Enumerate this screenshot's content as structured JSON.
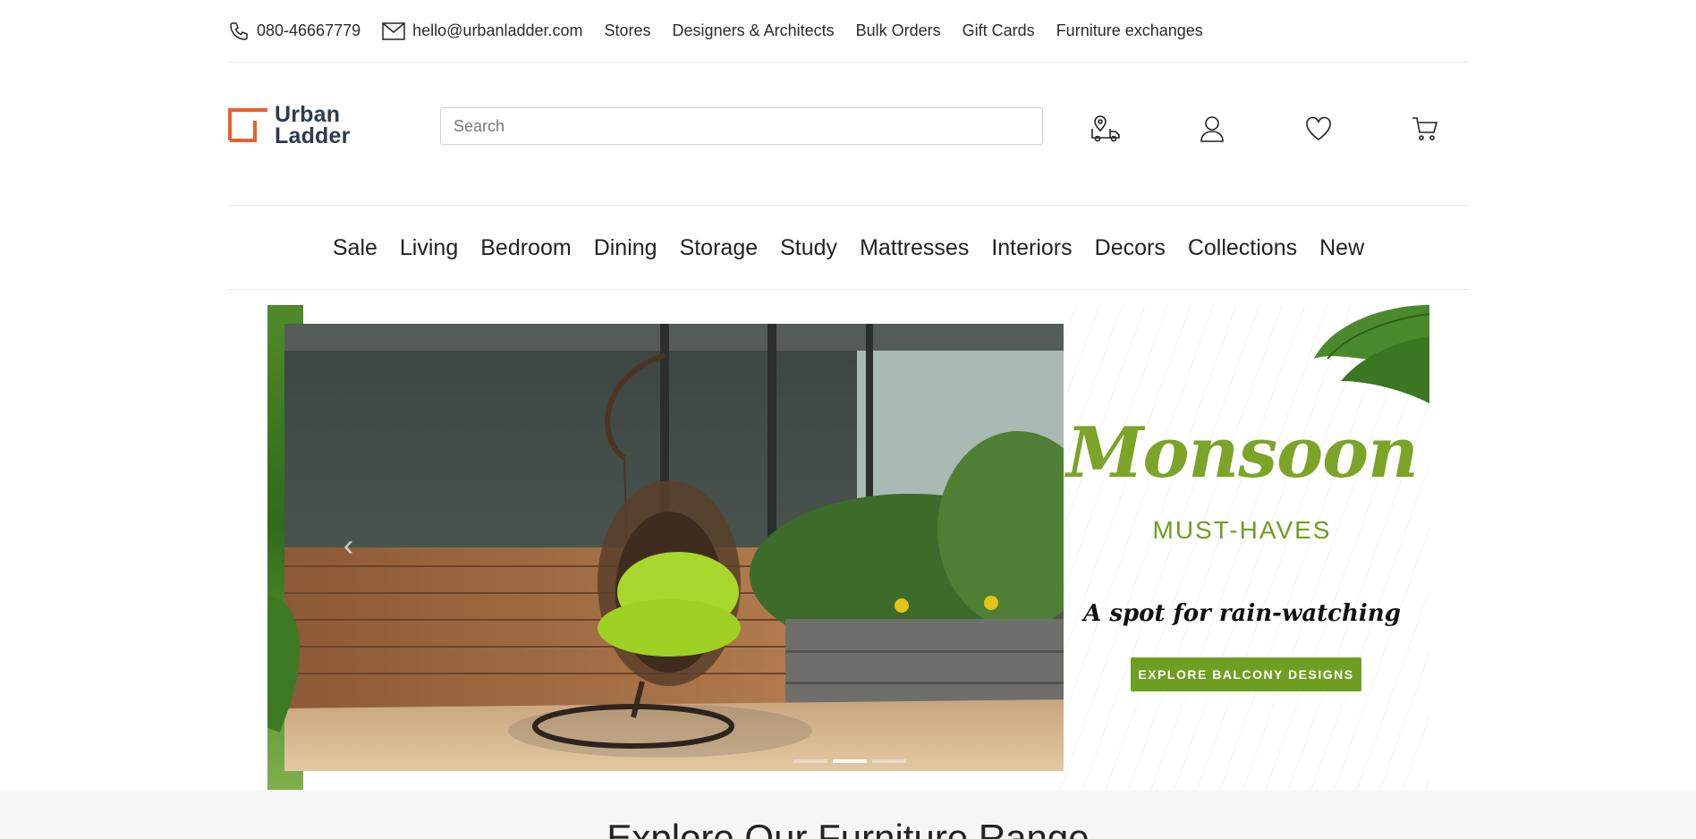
{
  "topbar": {
    "phone": "080-46667779",
    "email": "hello@urbanladder.com",
    "links": [
      "Stores",
      "Designers & Architects",
      "Bulk Orders",
      "Gift Cards",
      "Furniture exchanges"
    ]
  },
  "header": {
    "logo_line1": "Urban",
    "logo_line2": "Ladder",
    "search_placeholder": "Search",
    "icons": [
      "track-order-icon",
      "user-icon",
      "heart-icon",
      "cart-icon"
    ]
  },
  "nav": {
    "items": [
      "Sale",
      "Living",
      "Bedroom",
      "Dining",
      "Storage",
      "Study",
      "Mattresses",
      "Interiors",
      "Decors",
      "Collections",
      "New"
    ]
  },
  "hero": {
    "title": "Monsoon",
    "subtitle": "MUST-HAVES",
    "tagline": "A spot for rain-watching",
    "cta": "EXPLORE BALCONY DESIGNS",
    "prev_arrow": "‹",
    "active_slide": 2,
    "slide_count": 3
  },
  "explore": {
    "heading": "Explore Our Furniture Range"
  },
  "colors": {
    "brand_orange": "#e8602c",
    "brand_navy": "#2e3a4d",
    "monsoon_green": "#6e9e22"
  }
}
